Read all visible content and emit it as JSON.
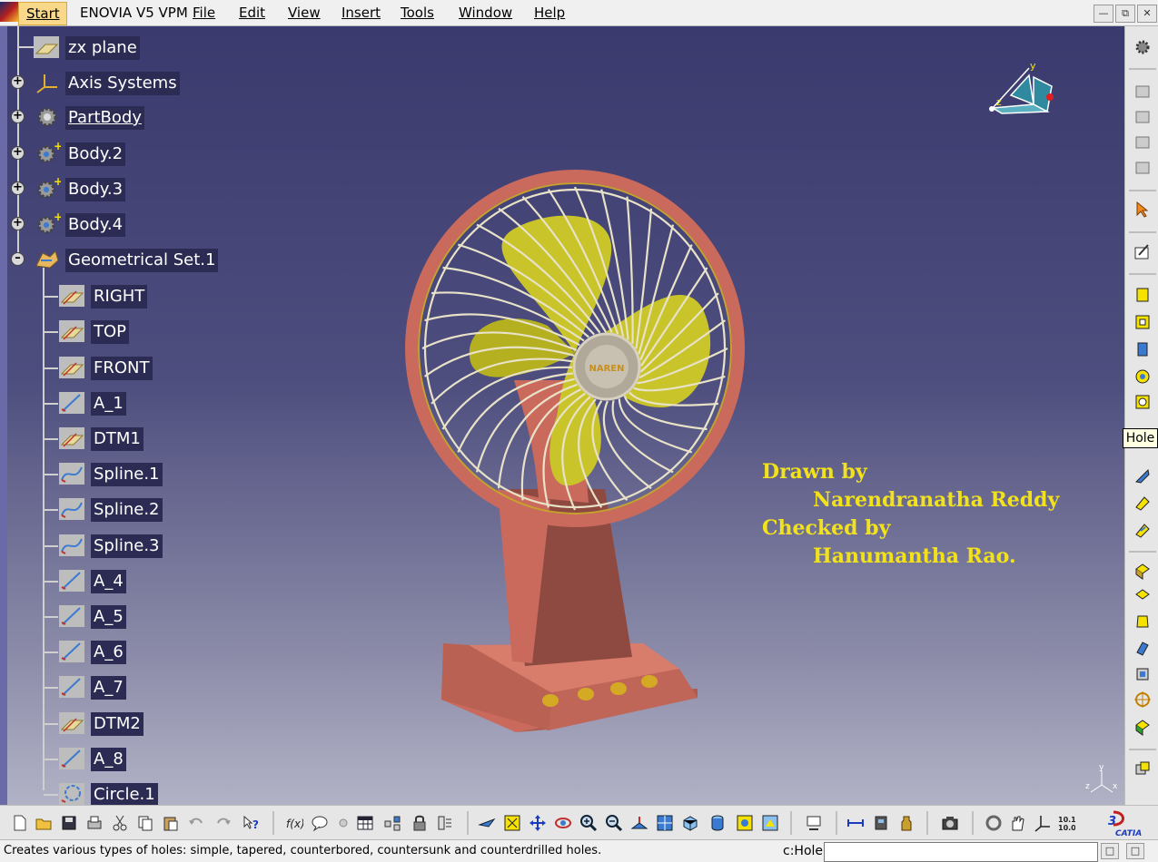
{
  "menubar": {
    "start": "Start",
    "app": "ENOVIA V5 VPM",
    "items": [
      "File",
      "Edit",
      "View",
      "Insert",
      "Tools",
      "Window",
      "Help"
    ],
    "window_controls": [
      "minimize",
      "restore",
      "close"
    ]
  },
  "tree": {
    "root_items": [
      {
        "label": "zx plane",
        "icon": "plane-icon"
      },
      {
        "label": "Axis Systems",
        "icon": "axis-icon",
        "expand": "+"
      },
      {
        "label": "PartBody",
        "icon": "partbody-gear-icon",
        "expand": "+",
        "underlined": true
      },
      {
        "label": "Body.2",
        "icon": "body-gear-icon",
        "expand": "+"
      },
      {
        "label": "Body.3",
        "icon": "body-gear-icon",
        "expand": "+"
      },
      {
        "label": "Body.4",
        "icon": "body-gear-icon",
        "expand": "+"
      },
      {
        "label": "Geometrical Set.1",
        "icon": "geometrical-set-icon",
        "expand": "-"
      }
    ],
    "children": [
      {
        "label": "RIGHT",
        "icon": "plane-icon"
      },
      {
        "label": "TOP",
        "icon": "plane-icon"
      },
      {
        "label": "FRONT",
        "icon": "plane-icon"
      },
      {
        "label": "A_1",
        "icon": "line-icon"
      },
      {
        "label": "DTM1",
        "icon": "plane-icon"
      },
      {
        "label": "Spline.1",
        "icon": "spline-icon"
      },
      {
        "label": "Spline.2",
        "icon": "spline-icon"
      },
      {
        "label": "Spline.3",
        "icon": "spline-icon"
      },
      {
        "label": "A_4",
        "icon": "line-icon"
      },
      {
        "label": "A_5",
        "icon": "line-icon"
      },
      {
        "label": "A_6",
        "icon": "line-icon"
      },
      {
        "label": "A_7",
        "icon": "line-icon"
      },
      {
        "label": "DTM2",
        "icon": "plane-icon"
      },
      {
        "label": "A_8",
        "icon": "line-icon"
      },
      {
        "label": "Circle.1",
        "icon": "circle-icon"
      }
    ]
  },
  "model": {
    "fan_badge": "NAREN"
  },
  "credits": {
    "drawn_label": "Drawn by",
    "drawn_name": "Narendranatha Reddy",
    "checked_label": "Checked by",
    "checked_name": "Hanumantha Rao."
  },
  "compass": {
    "axis_y": "y",
    "axis_z": "z"
  },
  "mini_axis": {
    "y": "y",
    "z": "z",
    "x": "x"
  },
  "tooltip": "Hole",
  "status": {
    "message": "Creates various types of holes: simple, tapered, counterbored, countersunk and counterdrilled holes.",
    "command_label": "c:Hole",
    "command_value": ""
  },
  "catia_logo": "CATIA",
  "colors": {
    "tree_label_bg": "#2b2b54",
    "credit_text": "#f2e21b",
    "fan_body": "#c96a5c",
    "fan_blades": "#c8c42a",
    "guard_wire": "#e8e2c8"
  }
}
